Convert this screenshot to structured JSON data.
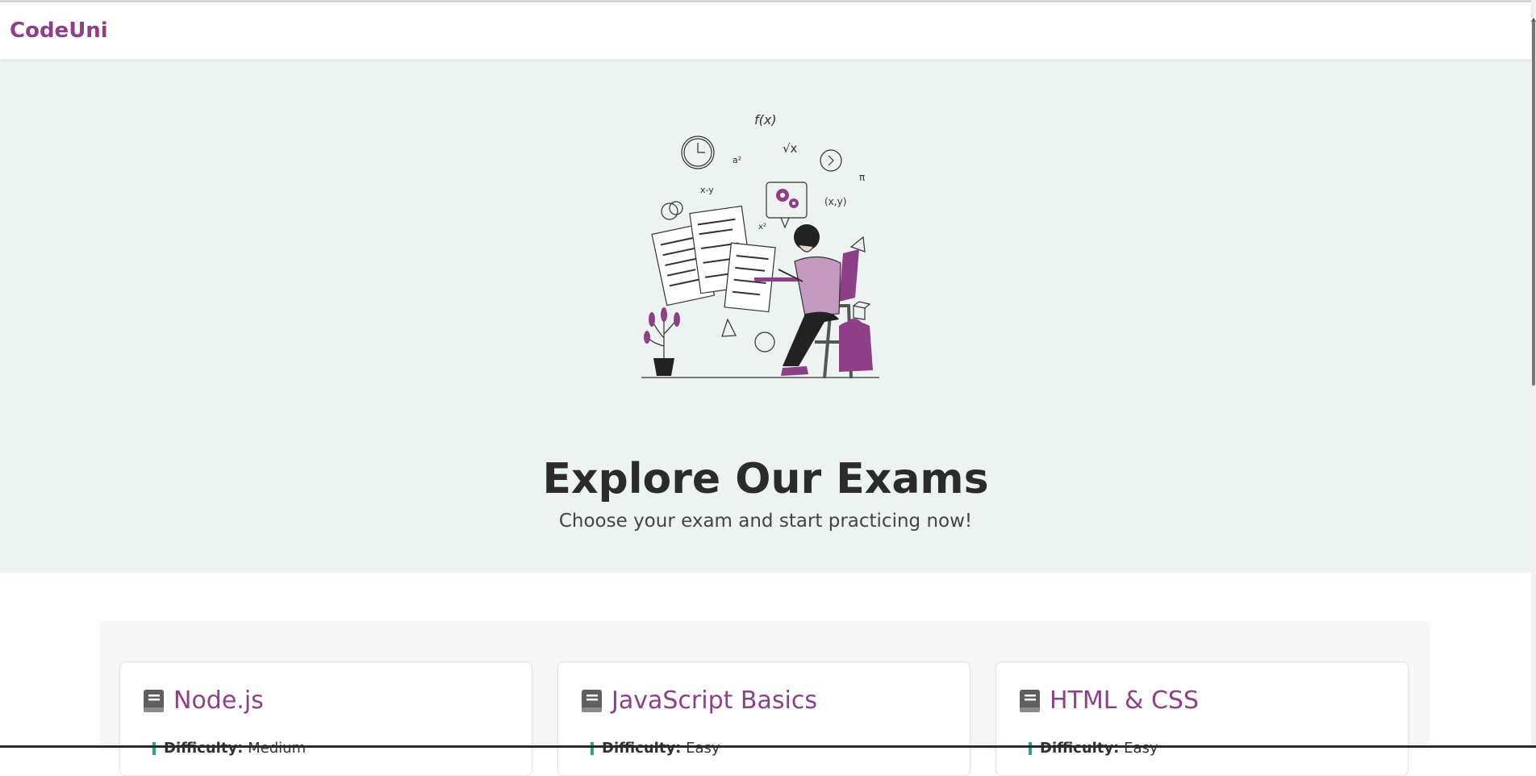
{
  "navbar": {
    "brand": "CodeUni"
  },
  "hero": {
    "title": "Explore Our Exams",
    "subtitle": "Choose your exam and start practicing now!",
    "illustration_icon": "student-exam-illustration"
  },
  "exams": [
    {
      "title": "Node.js",
      "difficulty_label": "Difficulty:",
      "difficulty_value": "Medium",
      "icon": "book-icon"
    },
    {
      "title": "JavaScript Basics",
      "difficulty_label": "Difficulty:",
      "difficulty_value": "Easy",
      "icon": "book-icon"
    },
    {
      "title": "HTML & CSS",
      "difficulty_label": "Difficulty:",
      "difficulty_value": "Easy",
      "icon": "book-icon"
    }
  ],
  "colors": {
    "brand": "#8e3f88",
    "hero_bg": "#edf3f1",
    "accent": "#29a98b"
  }
}
